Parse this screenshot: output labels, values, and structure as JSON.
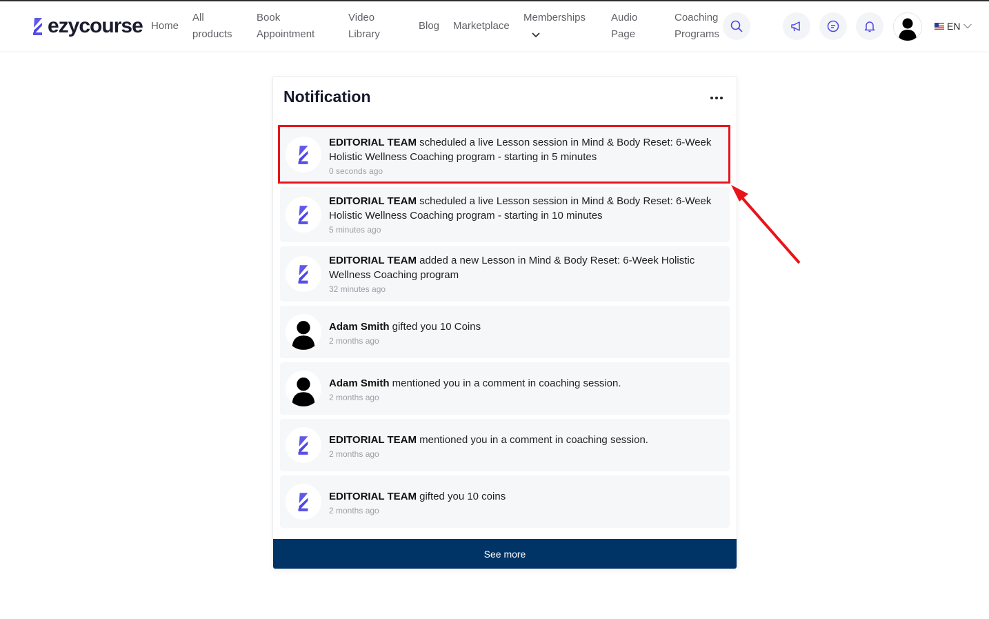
{
  "brand": {
    "name": "ezycourse",
    "accent": "#4f46e5"
  },
  "nav": {
    "items": [
      {
        "label_1": "Home",
        "label_2": ""
      },
      {
        "label_1": "All",
        "label_2": "products"
      },
      {
        "label_1": "Book",
        "label_2": "Appointment"
      },
      {
        "label_1": "Video",
        "label_2": "Library"
      },
      {
        "label_1": "Blog",
        "label_2": ""
      },
      {
        "label_1": "Marketplace",
        "label_2": ""
      },
      {
        "label_1": "Memberships",
        "label_2": ""
      },
      {
        "label_1": "Audio",
        "label_2": "Page"
      },
      {
        "label_1": "Coaching",
        "label_2": "Programs"
      }
    ],
    "language": "EN"
  },
  "notification_panel": {
    "title": "Notification",
    "see_more_label": "See more",
    "items": [
      {
        "actor": "EDITORIAL TEAM",
        "text": " scheduled a live Lesson session in Mind & Body Reset: 6-Week Holistic Wellness Coaching program - starting in 5 minutes",
        "time": "0 seconds ago",
        "avatar": "ezycourse-logo-icon"
      },
      {
        "actor": "EDITORIAL TEAM",
        "text": " scheduled a live Lesson session in Mind & Body Reset: 6-Week Holistic Wellness Coaching program - starting in 10 minutes",
        "time": "5 minutes ago",
        "avatar": "ezycourse-logo-icon"
      },
      {
        "actor": "EDITORIAL TEAM",
        "text": " added a new Lesson in Mind & Body Reset: 6-Week Holistic Wellness Coaching program",
        "time": "32 minutes ago",
        "avatar": "ezycourse-logo-icon"
      },
      {
        "actor": "Adam Smith",
        "text": " gifted you 10 Coins",
        "time": "2 months ago",
        "avatar": "person-icon"
      },
      {
        "actor": "Adam Smith",
        "text": " mentioned you in a comment in coaching session.",
        "time": "2 months ago",
        "avatar": "person-icon"
      },
      {
        "actor": "EDITORIAL TEAM",
        "text": " mentioned you in a comment in coaching session.",
        "time": "2 months ago",
        "avatar": "ezycourse-logo-icon"
      },
      {
        "actor": "EDITORIAL TEAM",
        "text": " gifted you 10 coins",
        "time": "2 months ago",
        "avatar": "ezycourse-logo-icon"
      }
    ]
  },
  "colors": {
    "highlight": "#e8141c",
    "button": "#003366",
    "item_bg": "#f6f7f9"
  }
}
